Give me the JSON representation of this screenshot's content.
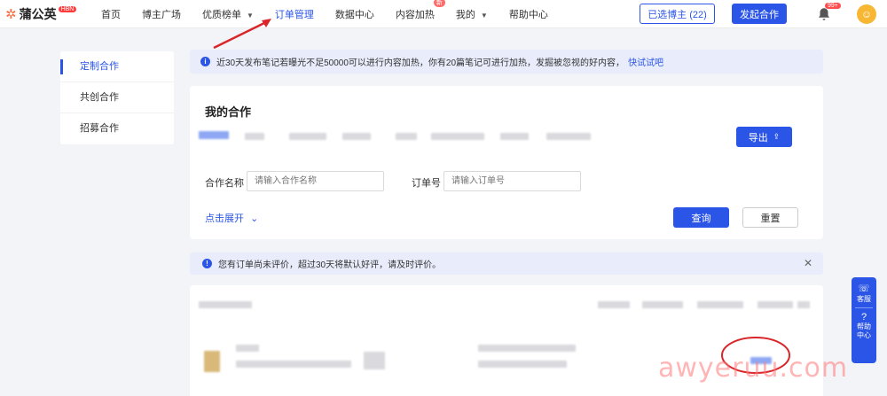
{
  "brand": {
    "name": "蒲公英",
    "badge": "HBN",
    "mark": "✲"
  },
  "nav": [
    {
      "label": "首页",
      "active": false,
      "caret": false
    },
    {
      "label": "博主广场",
      "active": false,
      "caret": false
    },
    {
      "label": "优质榜单",
      "active": false,
      "caret": true
    },
    {
      "label": "订单管理",
      "active": true,
      "caret": false
    },
    {
      "label": "数据中心",
      "active": false,
      "caret": false
    },
    {
      "label": "内容加热",
      "active": false,
      "caret": false,
      "badge": "新"
    },
    {
      "label": "我的",
      "active": false,
      "caret": true
    },
    {
      "label": "帮助中心",
      "active": false,
      "caret": false
    }
  ],
  "header": {
    "selected_label": "已选博主 (22)",
    "start_label": "发起合作",
    "bell_badge": "99+"
  },
  "sidebar": {
    "items": [
      {
        "label": "定制合作",
        "active": true
      },
      {
        "label": "共创合作",
        "active": false
      },
      {
        "label": "招募合作",
        "active": false
      }
    ]
  },
  "banner": {
    "text": "近30天发布笔记若曝光不足50000可以进行内容加热，你有20篇笔记可进行加热，发掘被忽视的好内容，",
    "link": "快试试吧"
  },
  "card": {
    "title": "我的合作",
    "export_label": "导出",
    "name_label": "合作名称",
    "name_placeholder": "请输入合作名称",
    "order_label": "订单号",
    "order_placeholder": "请输入订单号",
    "expand_label": "点击展开",
    "query_label": "查询",
    "reset_label": "重置"
  },
  "review_banner": {
    "text": "您有订单尚未评价，超过30天将默认好评，请及时评价。"
  },
  "float": {
    "service": "客服",
    "help": "帮助中心"
  },
  "watermark": "awyeruu.com",
  "colors": {
    "accent": "#2b55e6",
    "annotation": "#d9262b"
  }
}
